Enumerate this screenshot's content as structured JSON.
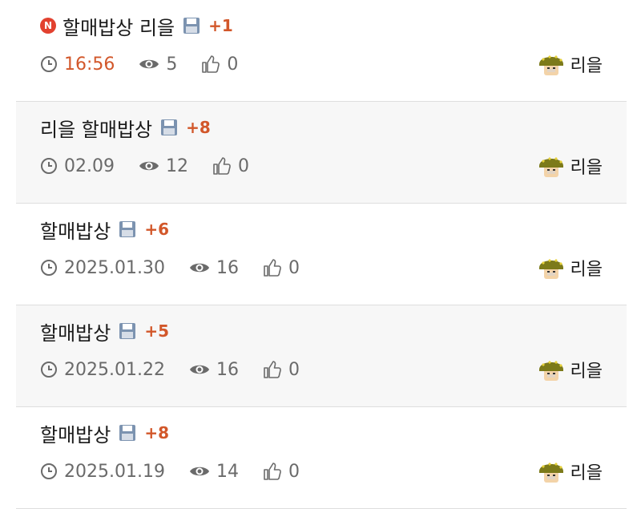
{
  "posts": [
    {
      "new_badge": "N",
      "title": "할매밥상 리을",
      "comments": "+1",
      "time": "16:56",
      "views": "5",
      "likes": "0",
      "author": "리을"
    },
    {
      "title": "리을 할매밥상",
      "comments": "+8",
      "time": "02.09",
      "views": "12",
      "likes": "0",
      "author": "리을"
    },
    {
      "title": "할매밥상",
      "comments": "+6",
      "time": "2025.01.30",
      "views": "16",
      "likes": "0",
      "author": "리을"
    },
    {
      "title": "할매밥상",
      "comments": "+5",
      "time": "2025.01.22",
      "views": "16",
      "likes": "0",
      "author": "리을"
    },
    {
      "title": "할매밥상",
      "comments": "+8",
      "time": "2025.01.19",
      "views": "14",
      "likes": "0",
      "author": "리을"
    }
  ],
  "icons": {
    "new": "new-badge-icon",
    "attachment": "floppy-disk-icon",
    "time": "clock-icon",
    "views": "eye-icon",
    "likes": "thumbs-up-icon",
    "avatar": "soldier-avatar-icon"
  },
  "colors": {
    "accent": "#d2572a",
    "new_badge": "#e2412f",
    "meta": "#6a6a6a",
    "alt_row": "#f7f7f7"
  }
}
